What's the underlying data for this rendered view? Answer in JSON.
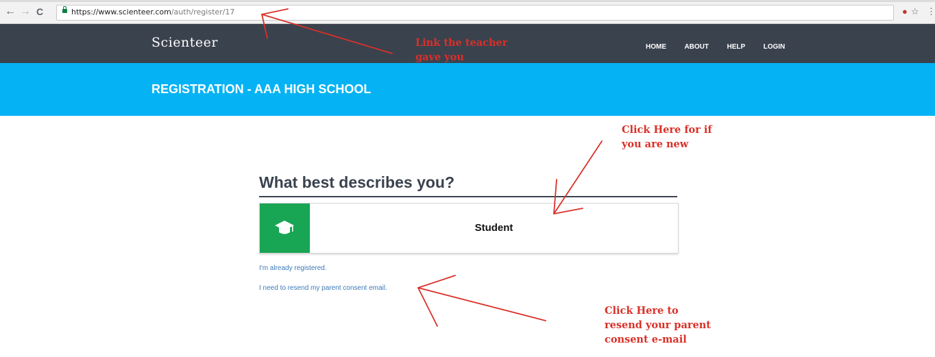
{
  "browser": {
    "back_icon": "←",
    "forward_icon": "→",
    "reload_icon": "C",
    "url_host": "https://www.scienteer.com",
    "url_path": "/auth/register/17",
    "ext_icons": [
      "extension-icon",
      "star-icon",
      "menu-icon"
    ]
  },
  "header": {
    "logo": "Scienteer",
    "nav": [
      "HOME",
      "ABOUT",
      "HELP",
      "LOGIN"
    ]
  },
  "banner": {
    "title": "REGISTRATION - AAA HIGH SCHOOL"
  },
  "main": {
    "question": "What best describes you?",
    "role_label": "Student",
    "role_icon": "graduation-cap-icon",
    "already_registered": "I'm already registered.",
    "resend_link": "I need to resend my parent consent email."
  },
  "annotations": {
    "color": "#d93028",
    "teacher_link": "Link the teacher gave you",
    "new_user": "Click Here for if you are new",
    "resend": "Click Here to resend your parent consent e-mail"
  },
  "colors": {
    "navbar": "#3a424e",
    "banner": "#05b3f4",
    "role_icon_bg": "#18a554",
    "link": "#3d7ab8"
  }
}
